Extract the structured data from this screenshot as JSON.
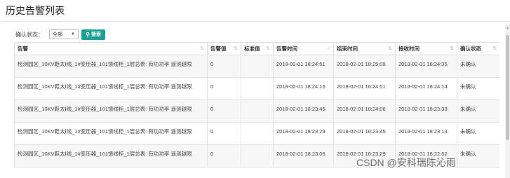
{
  "page": {
    "title": "历史告警列表"
  },
  "filter": {
    "label": "确认状态：",
    "select_value": "全部",
    "search_label": "搜索"
  },
  "table": {
    "headers": [
      "告警",
      "告警值",
      "标准值",
      "告警时间",
      "结束时间",
      "接收时间",
      "确认状态"
    ],
    "rows": [
      [
        "检测园区_10KV鞋太Ⅰ线_1#变压器_101馈线柜_1层总表: 有功功率 遥测越限",
        "0",
        "",
        "2018-02-01 18:24:51",
        "2018-02-01 18:25:09",
        "2018-02-01 18:24:35",
        "未确认"
      ],
      [
        "检测园区_10KV鞋太Ⅰ线_1#变压器_101馈线柜_1层总表: 有功功率 遥测越限",
        "0",
        "",
        "2018-02-01 18:24:16",
        "2018-02-01 18:24:51",
        "2018-02-01 18:24:14",
        "未确认"
      ],
      [
        "检测园区_10KV鞋太Ⅰ线_1#变压器_101馈线柜_1层总表: 有功功率 遥测越限",
        "0",
        "",
        "2018-02-01 18:23:45",
        "2018-02-01 18:24:06",
        "2018-02-01 18:23:33",
        "未确认"
      ],
      [
        "检测园区_10KV鞋太Ⅰ线_1#变压器_101馈线柜_1层总表: 有功功率 遥测越限",
        "0",
        "",
        "2018-02-01 18:23:29",
        "2018-02-01 18:23:45",
        "2018-02-01 18:23:13",
        "未确认"
      ],
      [
        "检测园区_10KV鞋太Ⅰ线_1#变压器_101馈线柜_1层总表: 有功功率 遥测越限",
        "0",
        "",
        "2018-02-01 18:23:06",
        "2018-02-01 18:23:29",
        "2018-02-01 18:22:52",
        "未确认"
      ]
    ]
  },
  "watermark": {
    "text": "CSDN @安科瑞陈沁雨"
  },
  "colors": {
    "accent": "#1aa094"
  }
}
